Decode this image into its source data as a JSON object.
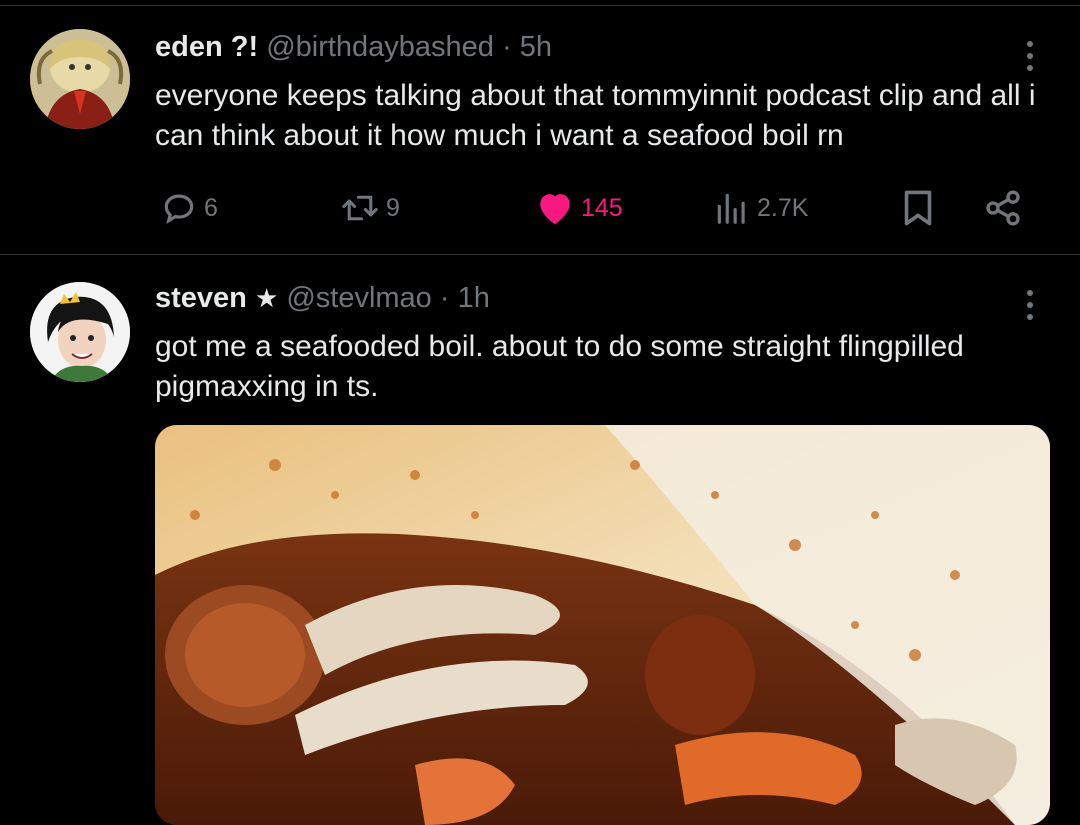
{
  "posts": [
    {
      "name": "eden ?!",
      "handle": "@birthdaybashed",
      "separator": "·",
      "time": "5h",
      "text": "everyone keeps talking about that tommyinnit podcast clip and all i can think about it how much i want a seafood boil rn",
      "actions": {
        "replies": "6",
        "reposts": "9",
        "likes": "145",
        "views": "2.7K"
      },
      "liked": true
    },
    {
      "name": "steven",
      "name_suffix": "★",
      "handle": "@stevlmao",
      "separator": "·",
      "time": "1h",
      "text": "got me a seafooded boil. about to do some straight flingpilled pigmaxxing in ts."
    }
  ],
  "colors": {
    "background": "#000000",
    "text": "#e7e9ea",
    "muted": "#71767b",
    "like": "#f91880",
    "divider": "#2f3336"
  },
  "icons": {
    "reply": "reply-icon",
    "repost": "repost-icon",
    "like": "heart-icon",
    "views": "views-icon",
    "bookmark": "bookmark-icon",
    "share": "share-icon",
    "more": "more-vertical-icon"
  }
}
